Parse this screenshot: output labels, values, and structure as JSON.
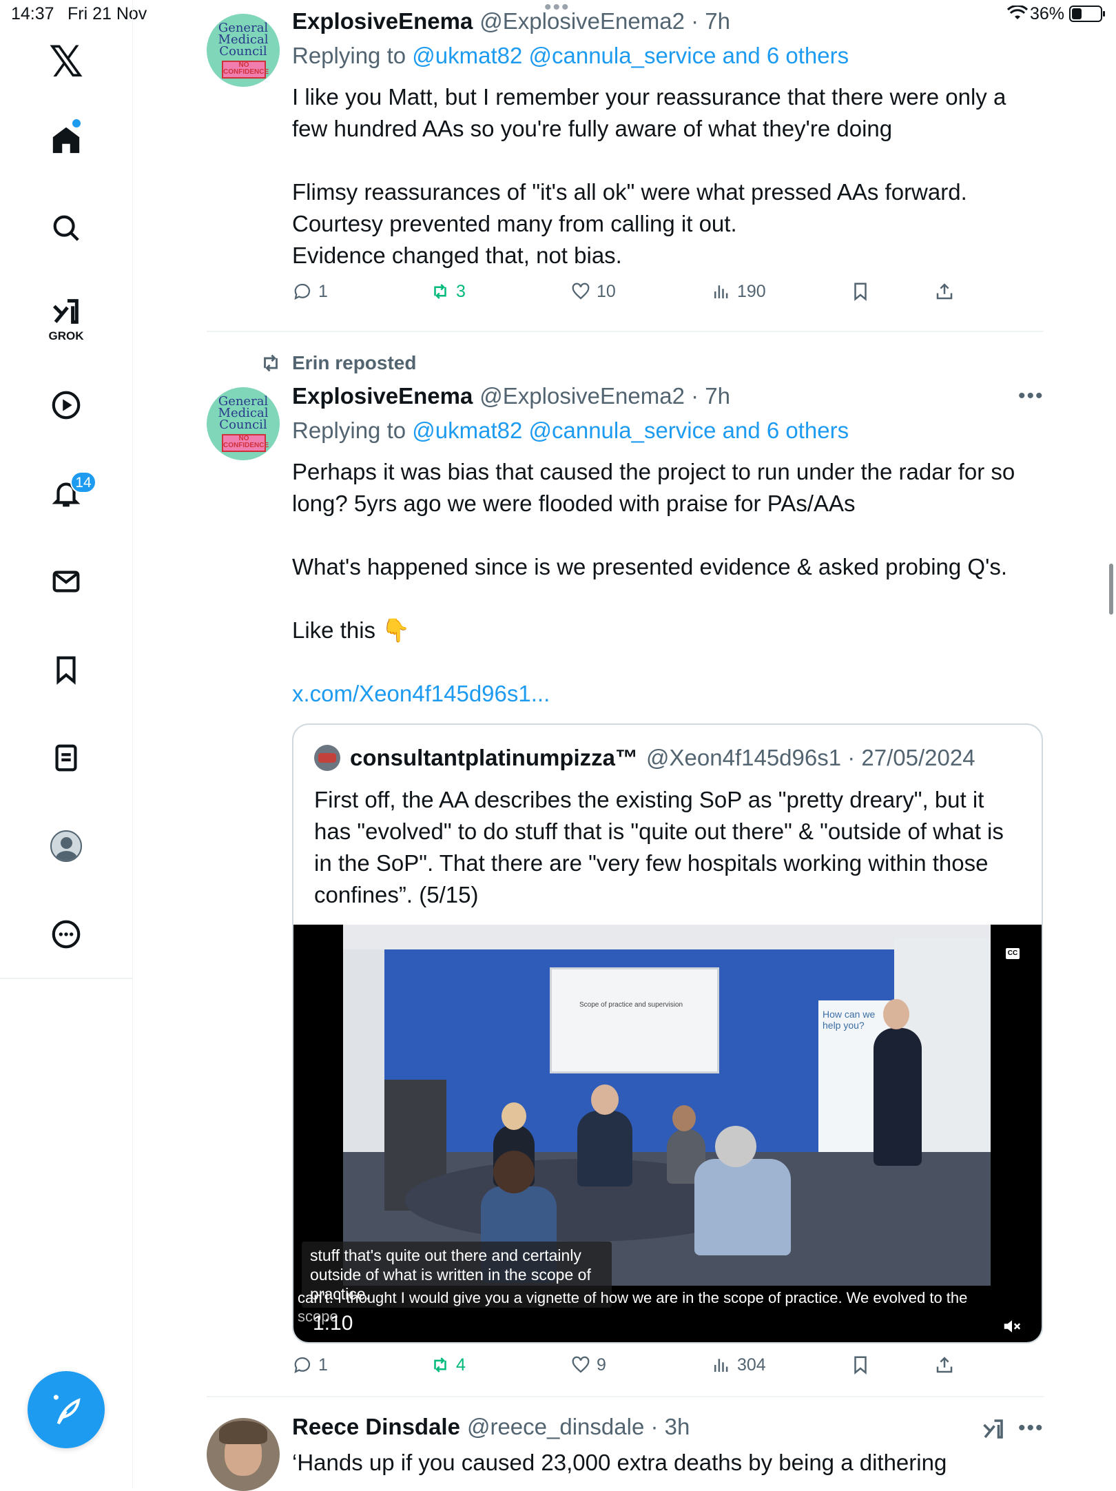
{
  "status_bar": {
    "time": "14:37",
    "date": "Fri 21 Nov",
    "battery": "36%"
  },
  "sidebar": {
    "logo": "𝕏",
    "grok_label": "GROK",
    "notification_count": "14",
    "items": [
      "home-icon",
      "search-icon",
      "grok-icon",
      "video-icon",
      "notifications-icon",
      "messages-icon",
      "bookmarks-icon",
      "lists-icon",
      "profile-icon",
      "more-icon"
    ]
  },
  "tweets": [
    {
      "name": "ExplosiveEnema",
      "handle": "@ExplosiveEnema2 · 7h",
      "reply_prefix": "Replying to ",
      "reply_to": "@ukmat82 @cannula_service and 6 others",
      "paragraphs": [
        "I like you Matt, but I remember your reassurance that there were only a few hundred AAs so you're fully aware of what they're doing",
        "Flimsy reassurances of \"it's all ok\" were what pressed AAs forward.",
        "Courtesy prevented many from calling it out.",
        "Evidence changed that, not bias."
      ],
      "replies": "1",
      "reposts": "3",
      "likes": "10",
      "views": "190"
    },
    {
      "repost_by": "Erin reposted",
      "name": "ExplosiveEnema",
      "handle": "@ExplosiveEnema2 · 7h",
      "reply_prefix": "Replying to ",
      "reply_to": "@ukmat82 @cannula_service and 6 others",
      "paragraph1": "Perhaps it was bias that caused the project to run under the radar for so long? 5yrs ago we were flooded with praise for PAs/AAs",
      "paragraph2": "What's happened since is we presented evidence & asked probing Q's.",
      "paragraph3": "Like this 👇",
      "link": "x.com/Xeon4f145d96s1...",
      "quote": {
        "name": "consultantplatinumpizza™",
        "handle": "@Xeon4f145d96s1 · 27/05/2024",
        "text": "First off, the AA describes the existing SoP as \"pretty dreary\", but it has \"evolved\" to do stuff that is \"quite out there\" & \"outside of what is in the SoP\". That there are \"very few hospitals working within those confines”. (5/15)",
        "video": {
          "screen_caption": "Scope of practice and supervision",
          "banner_caption": "How can we help you?",
          "subtitle": "stuff that's quite out there and certainly outside of what is written in the scope of practice.",
          "ticker": "can't.  I thought I would give you a vignette of how we are in the scope of practice.  We evolved to the",
          "ticker2": "scope",
          "duration": "1:10",
          "cc": "CC"
        }
      },
      "replies": "1",
      "reposts": "4",
      "likes": "9",
      "views": "304"
    },
    {
      "name": "Reece Dinsdale",
      "handle": "@reece_dinsdale · 3h",
      "text": "‘Hands up if you caused 23,000 extra deaths by being a dithering"
    }
  ],
  "colors": {
    "accent": "#1d9bf0",
    "repost_green": "#00ba7c",
    "muted": "#536471"
  }
}
